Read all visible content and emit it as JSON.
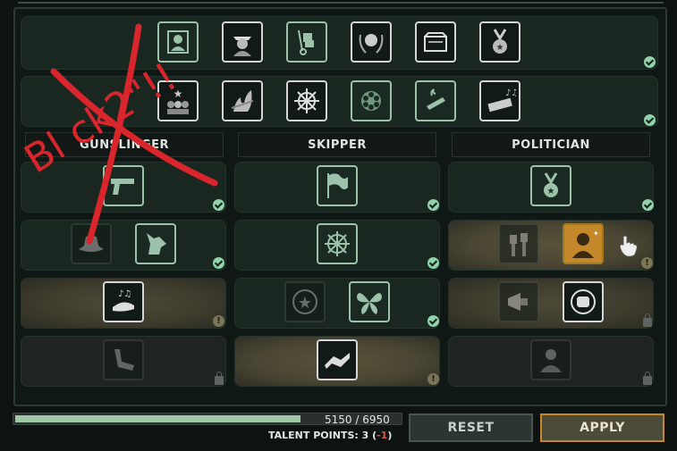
{
  "columns": [
    "GUNSLINGER",
    "SKIPPER",
    "POLITICIAN"
  ],
  "graffiti_text": "Bl ck2\"!!",
  "progress": {
    "current": 5150,
    "max": 6950,
    "label": "5150 / 6950",
    "fraction": 0.741
  },
  "talent_points": {
    "label": "TALENT POINTS: 3",
    "delta": "(-1)",
    "delta_prefix": " (",
    "delta_value": "-1",
    "delta_suffix": ")"
  },
  "buttons": {
    "reset": "RESET",
    "apply": "APPLY"
  },
  "colors": {
    "accent_green": "#8fd2ab",
    "apply_border": "#c8872a",
    "negative": "#e0524a",
    "graffiti": "#d8262c"
  },
  "icons": {
    "row1": [
      "photo-portrait-icon",
      "officer-icon",
      "hand-truck-icon",
      "laurel-head-icon",
      "briefcase-icon",
      "medal-icon"
    ],
    "row2": [
      "star-crowd-icon",
      "fire-rifle-icon",
      "ship-wheel-icon",
      "revolver-cylinder-icon",
      "cigar-icon",
      "harmonica-icon"
    ],
    "gunslinger": [
      "pistol-icon",
      "fedora-icon",
      "wolf-icon",
      "cap-music-icon",
      "handgun-icon"
    ],
    "skipper": [
      "flag-icon",
      "wheel-gear-icon",
      "star-badge-icon",
      "butterfly-icon",
      "handshake-icon"
    ],
    "politician": [
      "medal-stars-icon",
      "raised-fists-icon",
      "orator-icon",
      "megaphone-icon",
      "fist-target-icon",
      "bust-icon"
    ]
  }
}
